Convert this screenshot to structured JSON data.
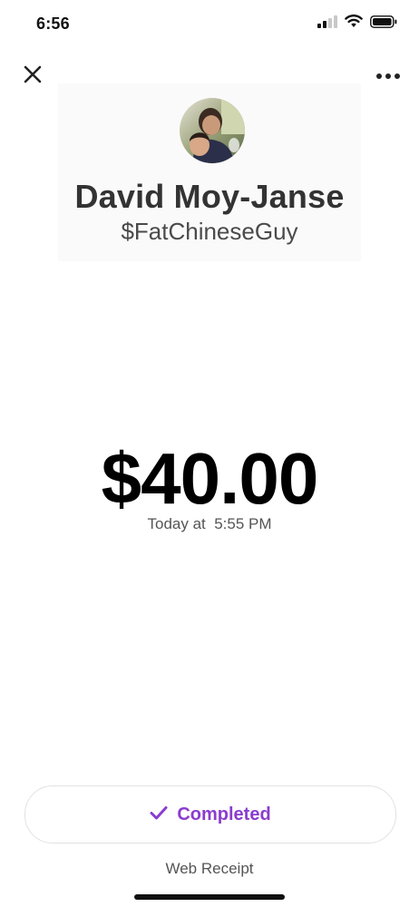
{
  "status_bar": {
    "time": "6:56",
    "icons": [
      "cellular-signal-icon",
      "wifi-icon",
      "battery-icon"
    ]
  },
  "top_bar": {
    "close_icon": "close-icon",
    "more_icon": "more-options-icon"
  },
  "profile": {
    "name": "David Moy-Janse",
    "handle": "$FatChineseGuy",
    "avatar": "profile-photo"
  },
  "transaction": {
    "amount": "$40.00",
    "timestamp": "Today at  5:55 PM"
  },
  "status": {
    "label": "Completed",
    "icon": "checkmark-icon",
    "color": "#8b3ccf"
  },
  "footer": {
    "web_receipt_label": "Web Receipt"
  }
}
